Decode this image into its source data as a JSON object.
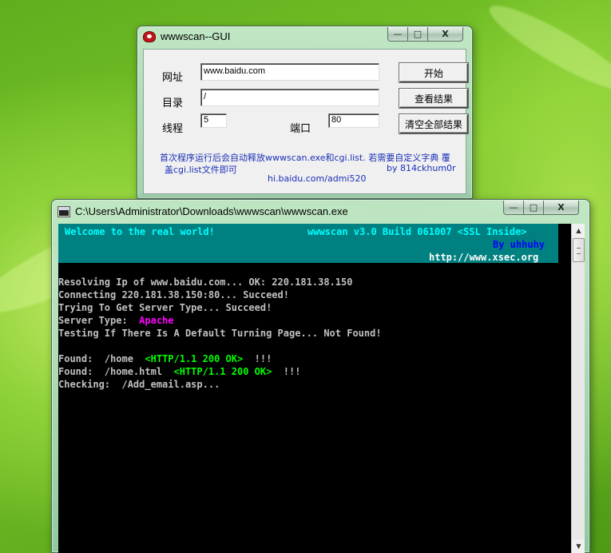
{
  "gui_window": {
    "title": "wwwscan--GUI",
    "caption_buttons": {
      "minimize": "—",
      "maximize": "□",
      "close": "X"
    },
    "url_label": "网址",
    "url_value": "www.baidu.com",
    "dir_label": "目录",
    "dir_value": "/",
    "threads_label": "线程",
    "threads_value": "5",
    "port_label": "端口",
    "port_value": "80",
    "start_button": "开始",
    "view_results_button": "查看结果",
    "clear_results_button": "清空全部结果",
    "note_line1": "首次程序运行后会自动释放wwwscan.exe和cgi.list.  若需要自定义字典 覆",
    "note_line2": "盖cgi.list文件即可",
    "note_author": "by 814ckhum0r",
    "note_site": "hi.baidu.com/admi520"
  },
  "console_window": {
    "title": "C:\\Users\\Administrator\\Downloads\\wwwscan\\wwwscan.exe",
    "caption_buttons": {
      "minimize": "—",
      "maximize": "□",
      "close": "X"
    },
    "banner": {
      "welcome": "Welcome to the real world!",
      "version": "wwwscan v3.0 Build 061007 <SSL Inside>",
      "by": "By uhhuhy",
      "url": "http://www.xsec.org"
    },
    "lines": {
      "resolving": "Resolving Ip of www.baidu.com... OK: 220.181.38.150",
      "connecting": "Connecting 220.181.38.150:80... Succeed!",
      "trying": "Trying To Get Server Type... Succeed!",
      "server_type_label": "Server Type:  ",
      "server_type_value": "Apache",
      "testing": "Testing If There Is A Default Turning Page... Not Found!",
      "found1_prefix": "Found:  /home  ",
      "found1_status": "<HTTP/1.1 200 OK>",
      "found1_suffix": "  !!!",
      "found2_prefix": "Found:  /home.html  ",
      "found2_status": "<HTTP/1.1 200 OK>",
      "found2_suffix": "  !!!",
      "checking": "Checking:  /Add_email.asp..."
    },
    "scroll": {
      "up_arrow": "▲",
      "down_arrow": "▼"
    }
  }
}
